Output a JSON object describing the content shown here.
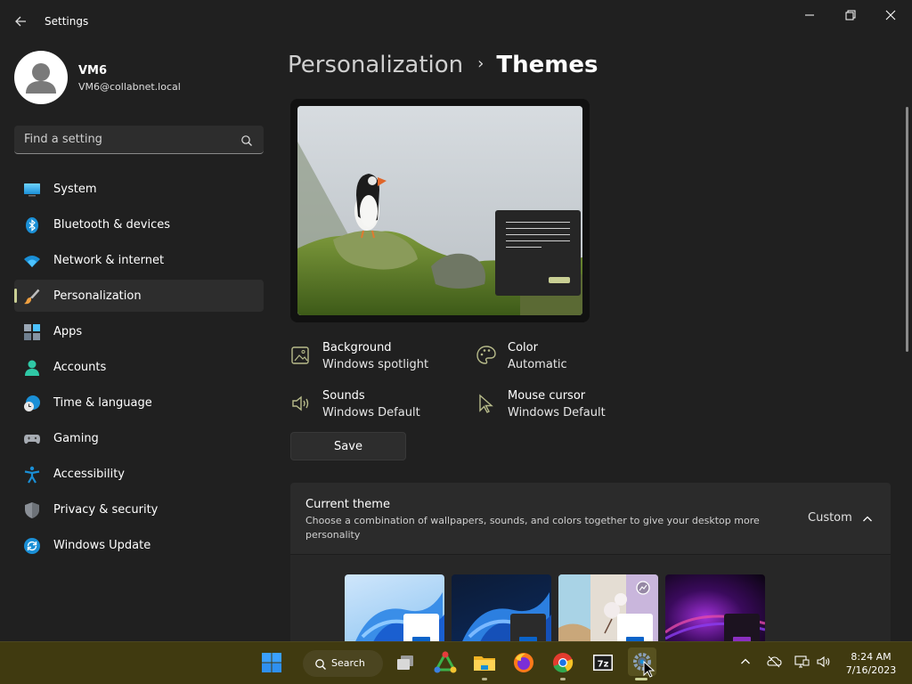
{
  "window": {
    "title": "Settings",
    "controls": [
      "minimize",
      "maximize",
      "close"
    ]
  },
  "profile": {
    "name": "VM6",
    "email": "VM6@collabnet.local"
  },
  "search": {
    "placeholder": "Find a setting"
  },
  "sidebar": {
    "items": [
      {
        "label": "System",
        "icon": "monitor-icon"
      },
      {
        "label": "Bluetooth & devices",
        "icon": "bluetooth-icon"
      },
      {
        "label": "Network & internet",
        "icon": "wifi-icon"
      },
      {
        "label": "Personalization",
        "icon": "brush-icon",
        "active": true
      },
      {
        "label": "Apps",
        "icon": "apps-icon"
      },
      {
        "label": "Accounts",
        "icon": "person-icon"
      },
      {
        "label": "Time & language",
        "icon": "globe-clock-icon"
      },
      {
        "label": "Gaming",
        "icon": "gamepad-icon"
      },
      {
        "label": "Accessibility",
        "icon": "accessibility-icon"
      },
      {
        "label": "Privacy & security",
        "icon": "shield-icon"
      },
      {
        "label": "Windows Update",
        "icon": "update-icon"
      }
    ]
  },
  "breadcrumb": {
    "parent": "Personalization",
    "separator": "›",
    "current": "Themes"
  },
  "theme_props": {
    "background": {
      "label": "Background",
      "value": "Windows spotlight"
    },
    "color": {
      "label": "Color",
      "value": "Automatic"
    },
    "sounds": {
      "label": "Sounds",
      "value": "Windows Default"
    },
    "cursor": {
      "label": "Mouse cursor",
      "value": "Windows Default"
    }
  },
  "save_label": "Save",
  "current_theme": {
    "title": "Current theme",
    "description": "Choose a combination of wallpapers, sounds, and colors together to give your desktop more personality",
    "value": "Custom"
  },
  "taskbar": {
    "search_label": "Search",
    "time": "8:24 AM",
    "date": "7/16/2023"
  },
  "colors": {
    "accent": "#c9cf94",
    "background": "#202020",
    "card": "#2b2b2b",
    "taskbar": "#403a10"
  }
}
